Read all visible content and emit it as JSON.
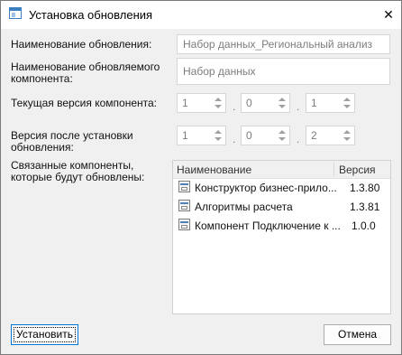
{
  "window": {
    "title": "Установка обновления",
    "close_glyph": "✕"
  },
  "labels": {
    "update_name": "Наименование обновления:",
    "updated_component_name": "Наименование обновляемого компонента:",
    "current_version": "Текущая версия компонента:",
    "version_after_install": "Версия после установки обновления:",
    "related_components": "Связанные компоненты, которые будут обновлены:"
  },
  "fields": {
    "update_name": "Набор данных_Региональный анализ",
    "updated_component_name": "Набор данных"
  },
  "current_version": [
    "1",
    "0",
    "1"
  ],
  "new_version": [
    "1",
    "0",
    "2"
  ],
  "version_separator": ".",
  "grid": {
    "columns": {
      "name": "Наименование",
      "version": "Версия"
    },
    "rows": [
      {
        "name": "Конструктор бизнес-прило...",
        "version": "1.3.80"
      },
      {
        "name": "Алгоритмы расчета",
        "version": "1.3.81"
      },
      {
        "name": "Компонент Подключение к ...",
        "version": "1.0.0"
      }
    ]
  },
  "buttons": {
    "install": "Установить",
    "cancel": "Отмена"
  }
}
